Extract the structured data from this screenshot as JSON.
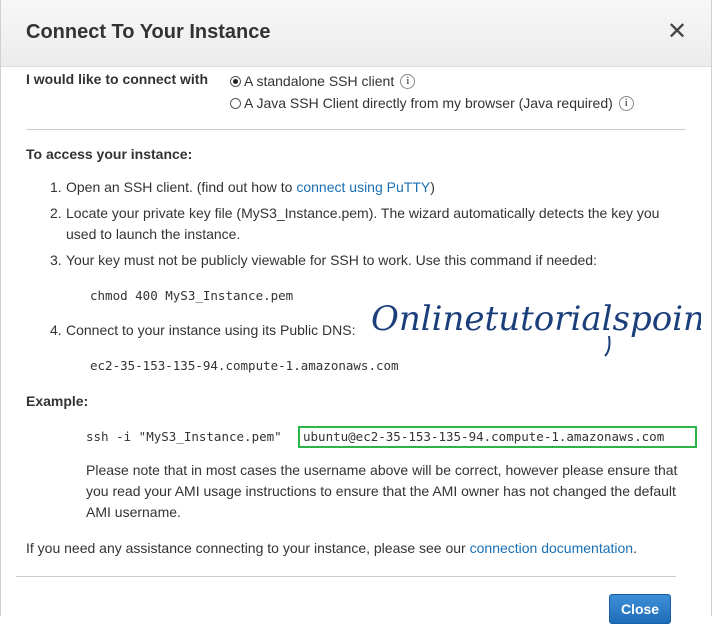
{
  "dialog": {
    "title": "Connect To Your Instance",
    "close_glyph": "✕",
    "close_button_label": "Close"
  },
  "connect_options": {
    "label": "I would like to connect with",
    "options": [
      {
        "label": "A standalone SSH client",
        "selected": true
      },
      {
        "label": "A Java SSH Client directly from my browser (Java required)",
        "selected": false
      }
    ]
  },
  "access": {
    "heading": "To access your instance:",
    "steps": [
      {
        "num": "1.",
        "text_before": "Open an SSH client. (find out how to ",
        "link": "connect using PuTTY",
        "text_after": ")"
      },
      {
        "num": "2.",
        "text": "Locate your private key file (MyS3_Instance.pem). The wizard automatically detects the key you used to launch the instance."
      },
      {
        "num": "3.",
        "text": "Your key must not be publicly viewable for SSH to work. Use this command if needed:"
      },
      {
        "num": "4.",
        "text": "Connect to your instance using its Public DNS:"
      }
    ],
    "chmod_command": "chmod 400 MyS3_Instance.pem",
    "public_dns": "ec2-35-153-135-94.compute-1.amazonaws.com"
  },
  "example": {
    "heading": "Example:",
    "ssh_prefix": "ssh -i \"MyS3_Instance.pem\"",
    "ssh_target": "ubuntu@ec2-35-153-135-94.compute-1.amazonaws.com",
    "note": "Please note that in most cases the username above will be correct, however please ensure that you read your AMI usage instructions to ensure that the AMI owner has not changed the default AMI username."
  },
  "footer": {
    "text": "If you need any assistance connecting to your instance, please see our ",
    "link": "connection documentation",
    "suffix": "."
  },
  "watermark_text": "Onlinetutorialspoint",
  "colors": {
    "link": "#1a6fb4",
    "highlight": "#2db34a",
    "button": "#1f6cb8",
    "watermark": "#1b3f7a"
  }
}
